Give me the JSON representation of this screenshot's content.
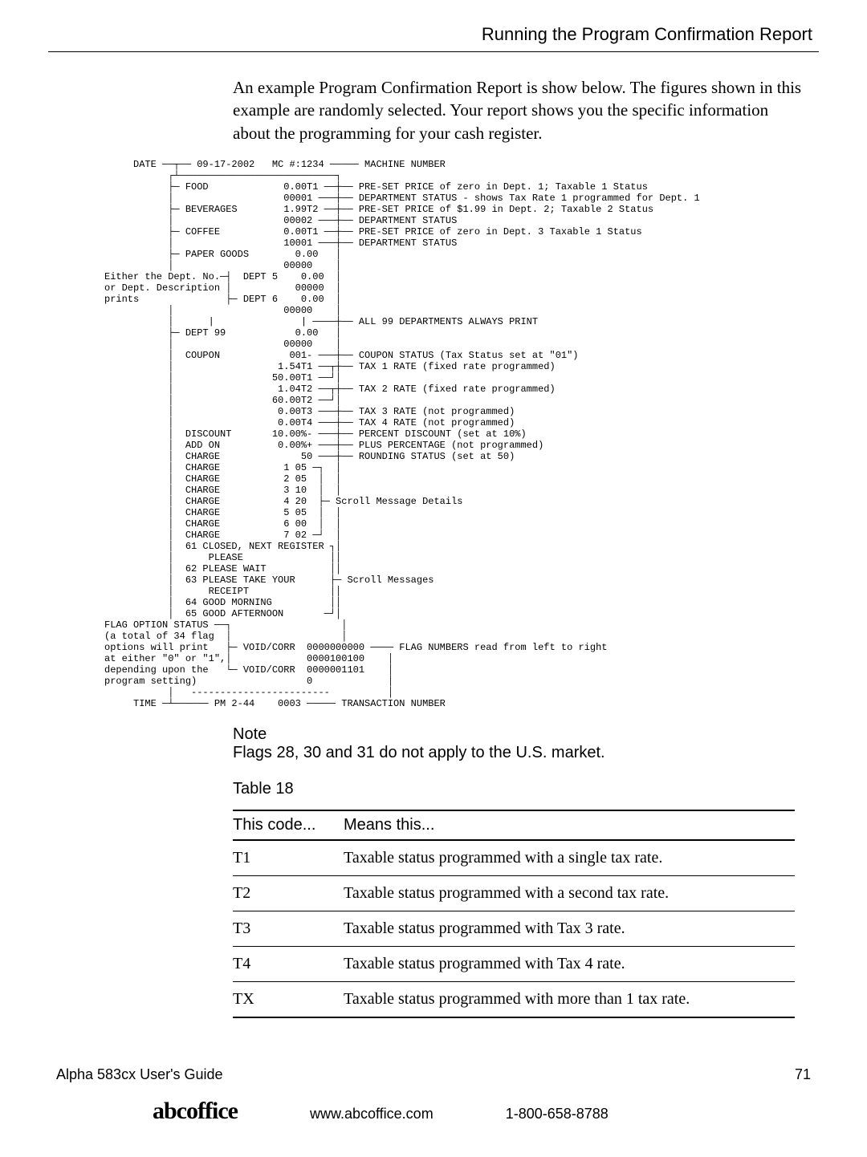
{
  "header": {
    "title": "Running the Program Confirmation Report"
  },
  "intro": "An example Program Confirmation Report is show below. The figures shown in this example are randomly selected. Your report shows you the specific information about the programming for your cash register.",
  "receipt_ascii": "     DATE ──┬── 09-17-2002   MC #:1234 ───── MACHINE NUMBER\n           ┌┴───────────────────────────┐\n           ├─ FOOD             0.00T1 ──┼── PRE-SET PRICE of zero in Dept. 1; Taxable 1 Status\n           │                   00001 ───┼── DEPARTMENT STATUS - shows Tax Rate 1 programmed for Dept. 1\n           ├─ BEVERAGES        1.99T2 ──┼── PRE-SET PRICE of $1.99 in Dept. 2; Taxable 2 Status\n           │                   00002 ───┼── DEPARTMENT STATUS\n           ├─ COFFEE           0.00T1 ──┼── PRE-SET PRICE of zero in Dept. 3 Taxable 1 Status\n           │                   10001 ───┼── DEPARTMENT STATUS\n           ├─ PAPER GOODS        0.00   │\n           │                   00000    │\nEither the Dept. No.─┤  DEPT 5    0.00  │\nor Dept. Description │           00000  │\nprints               ├─ DEPT 6    0.00  │\n           │                   00000    │\n           │      |               | ────┼── ALL 99 DEPARTMENTS ALWAYS PRINT\n           ├─ DEPT 99            0.00   │\n           │                   00000    │\n           │  COUPON            001- ───┼── COUPON STATUS (Tax Status set at \"01\")\n           │                  1.54T1 ──┬┼── TAX 1 RATE (fixed rate programmed)\n           │                 50.00T1 ──┘│\n           │                  1.04T2 ──┬┼── TAX 2 RATE (fixed rate programmed)\n           │                 60.00T2 ──┘│\n           │                  0.00T3 ───┼── TAX 3 RATE (not programmed)\n           │                  0.00T4 ───┼── TAX 4 RATE (not programmed)\n           │  DISCOUNT       10.00%- ───┼── PERCENT DISCOUNT (set at 10%)\n           │  ADD ON          0.00%+ ───┼── PLUS PERCENTAGE (not programmed)\n           │  CHARGE              50 ───┼── ROUNDING STATUS (set at 50)\n           │  CHARGE           1 05 ─┐  │\n           │  CHARGE           2 05  │  │\n           │  CHARGE           3 10  │  │\n           │  CHARGE           4 20  ├─ Scroll Message Details\n           │  CHARGE           5 05  │  │\n           │  CHARGE           6 00  │  │\n           │  CHARGE           7 02 ─┘  │\n           │  61 CLOSED, NEXT REGISTER ┐│\n           │      PLEASE               ││\n           │  62 PLEASE WAIT           ││\n           │  63 PLEASE TAKE YOUR      ├─ Scroll Messages\n           │      RECEIPT              ││\n           │  64 GOOD MORNING          ││\n           │  65 GOOD AFTERNOON       ─┘│\nFLAG OPTION STATUS ──┐                   │\n(a total of 34 flag  │                   │\noptions will print   ├─ VOID/CORR  0000000000 ──── FLAG NUMBERS read from left to right\nat either \"0\" or \"1\",│             0000100100    │\ndepending upon the   └─ VOID/CORR  0000001101    │\nprogram setting)                   0             │\n           │   ------------------------          │\n     TIME ─┴────── PM 2-44    0003 ───── TRANSACTION NUMBER",
  "note": {
    "label": "Note",
    "text": "Flags 28, 30 and 31 do not apply to the U.S. market."
  },
  "table": {
    "caption": "Table 18",
    "headers": {
      "col1": "This code...",
      "col2": "Means this..."
    },
    "rows": [
      {
        "code": "T1",
        "meaning": "Taxable status programmed with a single tax rate."
      },
      {
        "code": "T2",
        "meaning": "Taxable status programmed with a second tax rate."
      },
      {
        "code": "T3",
        "meaning": "Taxable status programmed with Tax 3 rate."
      },
      {
        "code": "T4",
        "meaning": "Taxable status programmed with Tax 4 rate."
      },
      {
        "code": "TX",
        "meaning": "Taxable status programmed with more than 1 tax rate."
      }
    ]
  },
  "footer": {
    "guide": "Alpha 583cx  User's Guide",
    "page": "71",
    "brand": "abcoffice",
    "url": "www.abcoffice.com",
    "phone": "1-800-658-8788"
  }
}
